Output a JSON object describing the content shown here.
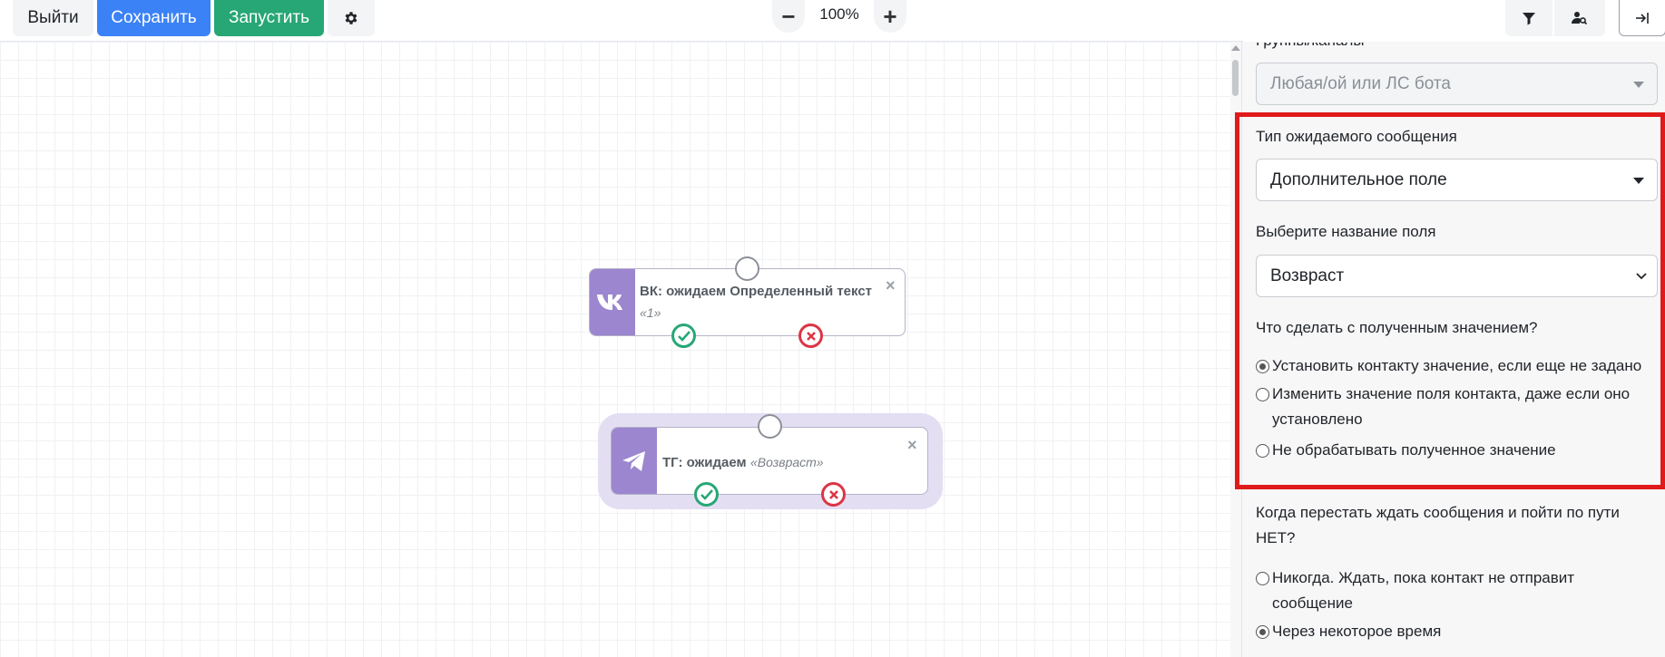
{
  "toolbar": {
    "exit_label": "Выйти",
    "save_label": "Сохранить",
    "run_label": "Запустить",
    "zoom_level": "100%",
    "zoom_out_symbol": "−",
    "zoom_in_symbol": "+",
    "colors": {
      "save": "#3b82f6",
      "run": "#27a776"
    }
  },
  "right_toolbar": {
    "icons": [
      "filter-icon",
      "user-search-icon",
      "collapse-panel-icon"
    ]
  },
  "nodes": [
    {
      "platform": "vk",
      "icon": "vk-logo-icon",
      "title": "ВК: ожидаем Определенный текст",
      "subtitle": "«1»"
    },
    {
      "platform": "telegram",
      "icon": "telegram-icon",
      "title": "ТГ: ожидаем",
      "subtitle": "«Возвраст»",
      "selected": true
    }
  ],
  "panel": {
    "groups_label": "Группы/каналы",
    "groups_value": "Любая/ой или ЛС бота",
    "message_type_label": "Тип ожидаемого сообщения",
    "message_type_value": "Дополнительное поле",
    "field_name_label": "Выберите название поля",
    "field_name_value": "Возвраст",
    "action_label": "Что сделать с полученным значением?",
    "action_options": [
      {
        "label": "Установить контакту значение, если еще не задано",
        "checked": true
      },
      {
        "label": "Изменить значение поля контакта, даже если оно установлено",
        "checked": false
      },
      {
        "label": "Не обрабатывать полученное значение",
        "checked": false
      }
    ],
    "stop_label": "Когда перестать ждать сообщения и пойти по пути НЕТ?",
    "stop_options": [
      {
        "label": "Никогда. Ждать, пока контакт не отправит сообщение",
        "checked": false
      },
      {
        "label": "Через некоторое время",
        "checked": true
      }
    ],
    "highlight_color": "#e01a1a"
  }
}
